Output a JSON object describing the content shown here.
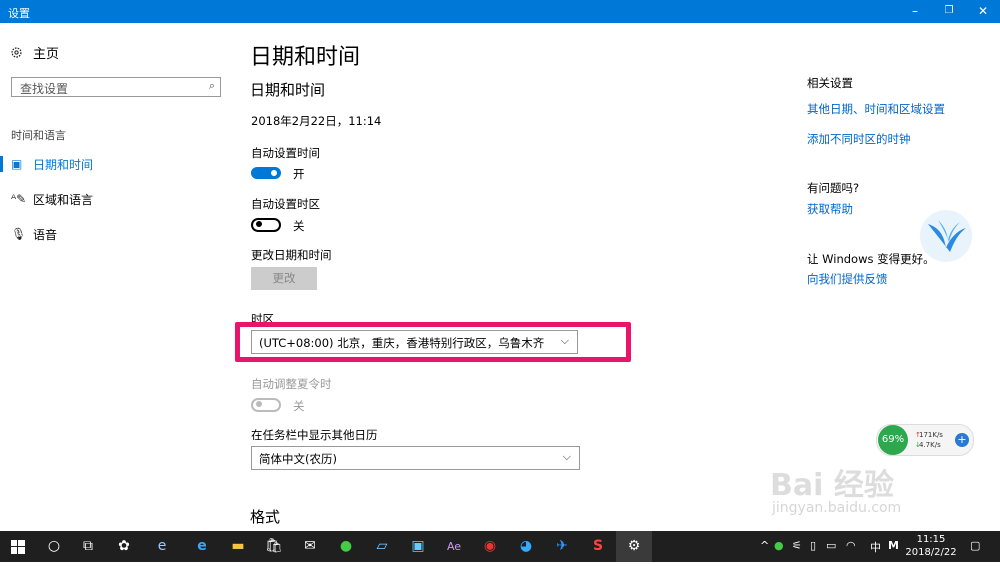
{
  "window": {
    "title": "设置",
    "minimize": "–",
    "maximize": "❐",
    "close": "✕"
  },
  "sidebar": {
    "home": "主页",
    "search_placeholder": "查找设置",
    "category": "时间和语言",
    "items": [
      {
        "label": "日期和时间",
        "icon": "calendar-clock-icon",
        "active": true
      },
      {
        "label": "区域和语言",
        "icon": "language-icon",
        "active": false
      },
      {
        "label": "语音",
        "icon": "microphone-icon",
        "active": false
      }
    ]
  },
  "main": {
    "page_title": "日期和时间",
    "section_title": "日期和时间",
    "current_datetime": "2018年2月22日，11:14",
    "auto_time_label": "自动设置时间",
    "auto_time_state": "开",
    "auto_timezone_label": "自动设置时区",
    "auto_timezone_state": "关",
    "change_datetime_label": "更改日期和时间",
    "change_button": "更改",
    "timezone_label": "时区",
    "timezone_value": "(UTC+08:00) 北京，重庆，香港特别行政区，乌鲁木齐",
    "dst_label": "自动调整夏令时",
    "dst_state": "关",
    "calendar_label": "在任务栏中显示其他日历",
    "calendar_value": "简体中文(农历)",
    "format_heading": "格式"
  },
  "right": {
    "related_title": "相关设置",
    "related_links": [
      "其他日期、时间和区域设置",
      "添加不同时区的时钟"
    ],
    "help_title": "有问题吗?",
    "help_link": "获取帮助",
    "improve_title": "让 Windows 变得更好。",
    "feedback_link": "向我们提供反馈"
  },
  "net_widget": {
    "percent": "69%",
    "up": "171K/s",
    "down": "4.7K/s",
    "plus": "+"
  },
  "watermark": {
    "main": "Bai 经验",
    "sub": "jingyan.baidu.com"
  },
  "taskbar": {
    "ime": "中",
    "ime_mode": "M",
    "time": "11:15",
    "date": "2018/2/22",
    "up_arrow": "^"
  },
  "colors": {
    "accent": "#0078d7",
    "highlight": "#e8156a",
    "taskbar": "#1f1f1f"
  }
}
